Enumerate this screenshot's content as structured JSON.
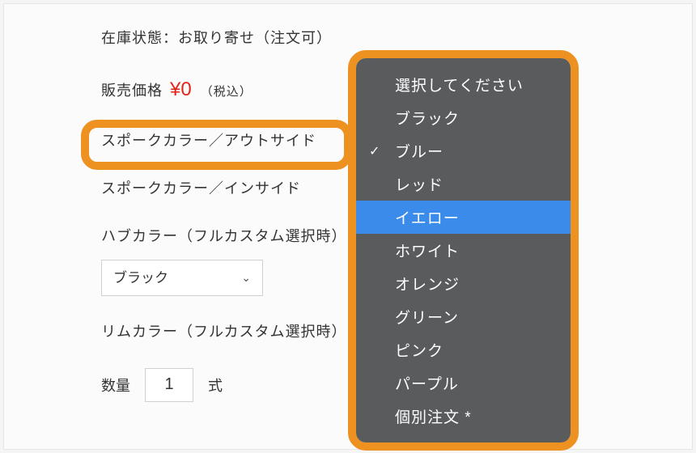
{
  "stock": {
    "label": "在庫状態：お取り寄せ（注文可）"
  },
  "price": {
    "label": "販売価格",
    "value": "¥0",
    "tax": "（税込）"
  },
  "options": {
    "spoke_outside": "スポークカラー／アウトサイド",
    "spoke_inside": "スポークカラー／インサイド",
    "hub": "ハブカラー（フルカスタム選択時）",
    "hub_value": "ブラック",
    "rim": "リムカラー（フルカスタム選択時）"
  },
  "quantity": {
    "label": "数量",
    "value": "1",
    "unit": "式"
  },
  "dropdown": {
    "selected_index": 2,
    "highlighted_index": 4,
    "items": [
      "選択してください",
      "ブラック",
      "ブルー",
      "レッド",
      "イエロー",
      "ホワイト",
      "オレンジ",
      "グリーン",
      "ピンク",
      "パープル",
      "個別注文 *"
    ]
  }
}
